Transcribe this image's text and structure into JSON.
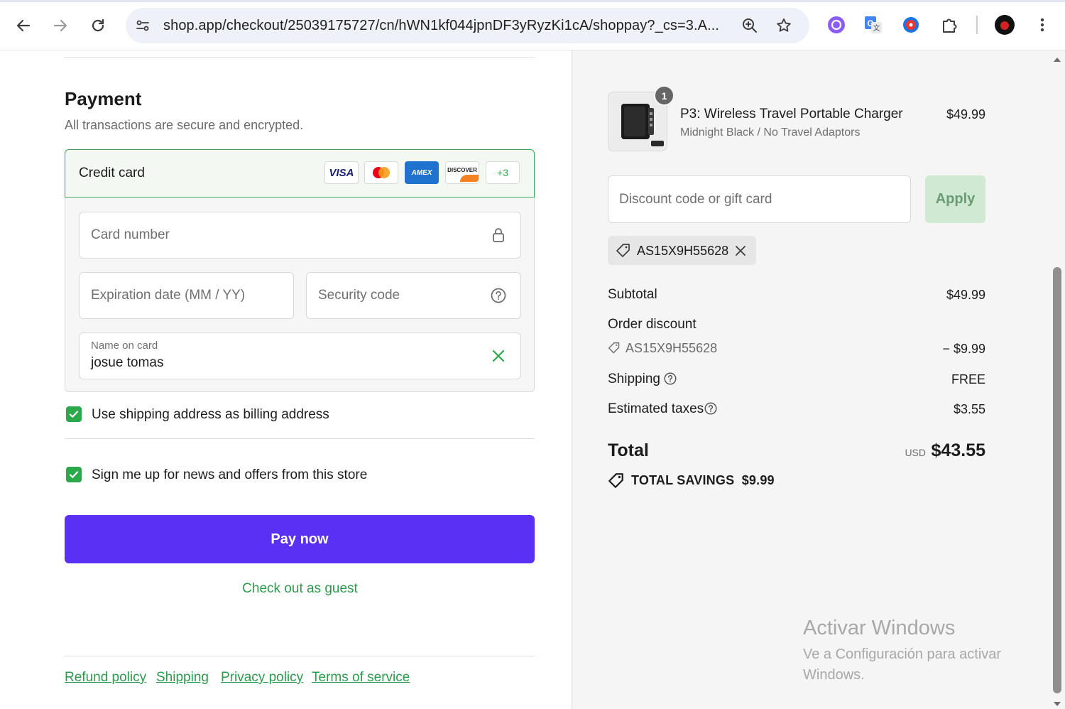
{
  "browser": {
    "url": "shop.app/checkout/25039175727/cn/hWN1kf044jpnDF3yRyzKi1cA/shoppay?_cs=3.A..."
  },
  "payment": {
    "title": "Payment",
    "subtitle": "All transactions are secure and encrypted.",
    "method_label": "Credit card",
    "card_brands": [
      "VISA",
      "MASTERCARD",
      "AMEX",
      "DISCOVER"
    ],
    "more_brands": "+3",
    "card_number_placeholder": "Card number",
    "expiration_placeholder": "Expiration date (MM / YY)",
    "security_code_placeholder": "Security code",
    "name_label": "Name on card",
    "name_value": "josue tomas",
    "billing_checkbox_label": "Use shipping address as billing address",
    "billing_checked": true,
    "newsletter_checkbox_label": "Sign me up for news and offers from this store",
    "newsletter_checked": true,
    "pay_button": "Pay now",
    "guest_link": "Check out as guest"
  },
  "footer": {
    "links": [
      "Refund policy",
      "Shipping",
      "Privacy policy",
      "Terms of service"
    ]
  },
  "order": {
    "item": {
      "quantity": "1",
      "name": "P3: Wireless Travel Portable Charger",
      "variant": "Midnight Black / No Travel Adaptors",
      "price": "$49.99"
    },
    "discount_placeholder": "Discount code or gift card",
    "apply_button": "Apply",
    "applied_code": "AS15X9H55628",
    "subtotal_label": "Subtotal",
    "subtotal_value": "$49.99",
    "order_discount_label": "Order discount",
    "order_discount_code": "AS15X9H55628",
    "order_discount_value": "− $9.99",
    "shipping_label": "Shipping",
    "shipping_value": "FREE",
    "taxes_label": "Estimated taxes",
    "taxes_value": "$3.55",
    "total_label": "Total",
    "total_currency": "USD",
    "total_value": "$43.55",
    "savings_label": "TOTAL SAVINGS",
    "savings_value": "$9.99"
  },
  "watermark": {
    "title": "Activar Windows",
    "subtitle": "Ve a Configuración para activar Windows."
  },
  "colors": {
    "accent_green": "#2ba84a",
    "pay_button": "#5a31f4"
  }
}
